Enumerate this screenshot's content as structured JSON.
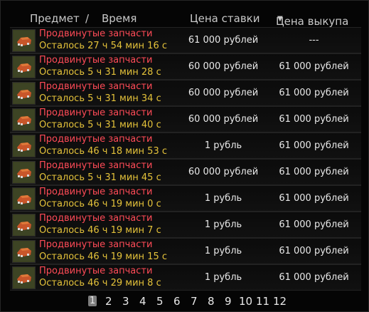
{
  "header": {
    "item": "Предмет",
    "separator": "/",
    "time": "Время",
    "bid": "Цена ставки",
    "buyout": "Цена выкупа",
    "sort_icon": "triangle-down-icon"
  },
  "rows": [
    {
      "name": "Продвинутые запчасти",
      "time_left": "Осталось 27 ч 54 мин 16 с",
      "bid": "61 000 рублей",
      "buyout": "---"
    },
    {
      "name": "Продвинутые запчасти",
      "time_left": "Осталось 5 ч 31 мин 28 с",
      "bid": "60 000 рублей",
      "buyout": "61 000 рублей"
    },
    {
      "name": "Продвинутые запчасти",
      "time_left": "Осталось 5 ч 31 мин 34 с",
      "bid": "60 000 рублей",
      "buyout": "61 000 рублей"
    },
    {
      "name": "Продвинутые запчасти",
      "time_left": "Осталось 5 ч 31 мин 40 с",
      "bid": "60 000 рублей",
      "buyout": "61 000 рублей"
    },
    {
      "name": "Продвинутые запчасти",
      "time_left": "Осталось 46 ч 18 мин 53 с",
      "bid": "1 рубль",
      "buyout": "61 000 рублей"
    },
    {
      "name": "Продвинутые запчасти",
      "time_left": "Осталось 5 ч 31 мин 45 с",
      "bid": "60 000 рублей",
      "buyout": "61 000 рублей"
    },
    {
      "name": "Продвинутые запчасти",
      "time_left": "Осталось 46 ч 19 мин 0 с",
      "bid": "1 рубль",
      "buyout": "61 000 рублей"
    },
    {
      "name": "Продвинутые запчасти",
      "time_left": "Осталось 46 ч 19 мин 7 с",
      "bid": "1 рубль",
      "buyout": "61 000 рублей"
    },
    {
      "name": "Продвинутые запчасти",
      "time_left": "Осталось 46 ч 19 мин 15 с",
      "bid": "1 рубль",
      "buyout": "61 000 рублей"
    },
    {
      "name": "Продвинутые запчасти",
      "time_left": "Осталось 46 ч 29 мин 8 с",
      "bid": "1 рубль",
      "buyout": "61 000 рублей"
    }
  ],
  "pager": {
    "current": "1",
    "pages": [
      "1",
      "2",
      "3",
      "4",
      "5",
      "6",
      "7",
      "8",
      "9",
      "10",
      "11",
      "12"
    ]
  },
  "colors": {
    "item_name": "#ff4b57",
    "time_left": "#e4c23a",
    "price": "#e9e9e9",
    "header": "#c8c8c8"
  },
  "item_icon": "spare-parts-icon"
}
